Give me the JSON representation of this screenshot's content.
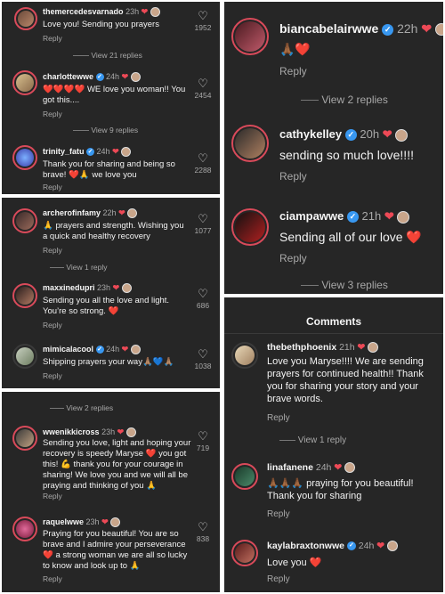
{
  "panel1": {
    "comments": [
      {
        "username": "themercedesvarnado",
        "time": "23h",
        "text": "Love you! Sending you prayers",
        "reply": "Reply",
        "likes": "1952"
      },
      {
        "username": "charlottewwe",
        "time": "24h",
        "text": "❤️❤️❤️❤️ WE love you woman!! You got this....",
        "reply": "Reply",
        "likes": "2454"
      },
      {
        "username": "trinity_fatu",
        "time": "24h",
        "text": "Thank you for sharing and being so brave! ❤️🙏 we love you",
        "reply": "Reply",
        "likes": "2288"
      }
    ],
    "view_replies": [
      "View 21 replies",
      "View 9 replies"
    ]
  },
  "panel2": {
    "comments": [
      {
        "username": "archerofinfamy",
        "time": "22h",
        "text": "🙏 prayers and strength. Wishing you a quick and healthy recovery",
        "reply": "Reply",
        "likes": "1077"
      },
      {
        "username": "maxxinedupri",
        "time": "23h",
        "text": "Sending you all the love and light. You’re so strong. ❤️",
        "reply": "Reply",
        "likes": "686"
      },
      {
        "username": "mimicalacool",
        "time": "24h",
        "text": "Shipping prayers your way🙏🏽💙🙏🏽",
        "reply": "Reply",
        "likes": "1038"
      }
    ],
    "view_replies": [
      "View 1 reply"
    ]
  },
  "panel3": {
    "top_view_replies": "View 2 replies",
    "comments": [
      {
        "username": "wwenikkicross",
        "time": "23h",
        "text": "Sending you love, light and hoping your recovery is speedy Maryse ❤️ you got this! 💪 thank you for your courage in sharing! We love you and we will all be praying and thinking of you 🙏",
        "reply": "Reply",
        "likes": "719"
      },
      {
        "username": "raquelwwe",
        "time": "23h",
        "text": "Praying for you beautiful! You are so brave and I admire your perseverance ❤️ a strong woman we are all so lucky to know and look up to 🙏",
        "reply": "Reply",
        "likes": "838"
      }
    ]
  },
  "panel4": {
    "comments": [
      {
        "username": "biancabelairwwe",
        "time": "22h",
        "text": "🙏🏾❤️",
        "reply": "Reply"
      },
      {
        "username": "cathykelley",
        "time": "20h",
        "text": "sending so much love!!!!",
        "reply": "Reply"
      },
      {
        "username": "ciampawwe",
        "time": "21h",
        "text": "Sending all of our love ❤️",
        "reply": "Reply"
      }
    ],
    "view_replies": [
      "View 2 replies",
      "View 3 replies"
    ]
  },
  "panel5": {
    "title": "Comments",
    "comments": [
      {
        "username": "thebethphoenix",
        "time": "21h",
        "text": "Love you Maryse!!!! We are sending prayers for continued health!! Thank you for sharing your story and your brave words.",
        "reply": "Reply"
      },
      {
        "username": "linafanene",
        "time": "24h",
        "text": "🙏🏾🙏🏾🙏🏾 praying for you beautiful! Thank you for sharing",
        "reply": "Reply"
      },
      {
        "username": "kaylabraxtonwwe",
        "time": "24h",
        "text": "Love you ❤️",
        "reply": "Reply"
      }
    ],
    "view_replies": [
      "View 1 reply"
    ]
  },
  "icons": {
    "heart_outline": "heart-outline-icon",
    "verified": "verified-badge-icon",
    "liked_heart": "red-heart-icon"
  },
  "colors": {
    "panel_bg": "#262626",
    "verified_blue": "#3897f0",
    "heart_red": "#ed4956",
    "muted_text": "#a8a8a8"
  }
}
